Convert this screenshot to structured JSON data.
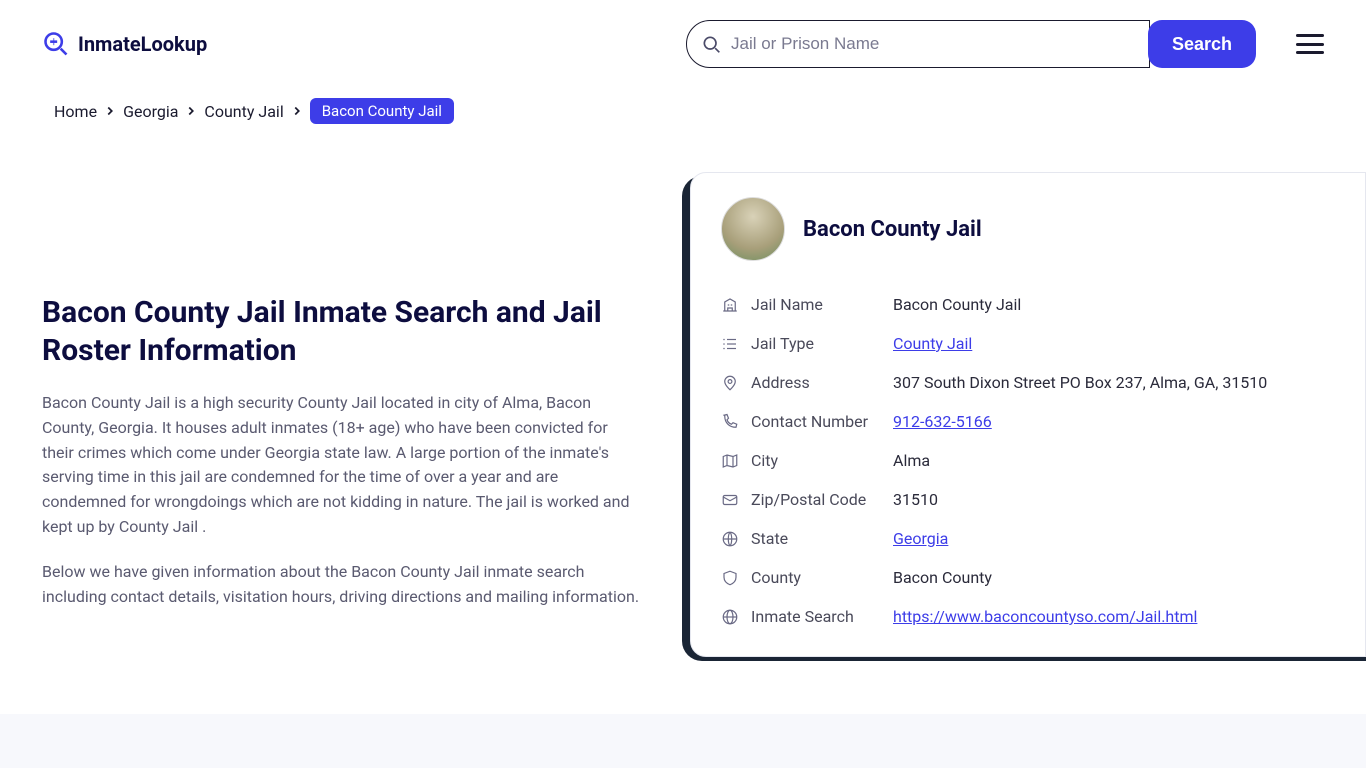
{
  "header": {
    "logo_text": "InmateLookup",
    "search_placeholder": "Jail or Prison Name",
    "search_button": "Search"
  },
  "breadcrumb": {
    "items": [
      "Home",
      "Georgia",
      "County Jail"
    ],
    "current": "Bacon County Jail"
  },
  "content": {
    "title": "Bacon County Jail Inmate Search and Jail Roster Information",
    "para1": "Bacon County Jail is a high security County Jail located in city of Alma, Bacon County, Georgia. It houses adult inmates (18+ age) who have been convicted for their crimes which come under Georgia state law. A large portion of the inmate's serving time in this jail are condemned for the time of over a year and are condemned for wrongdoings which are not kidding in nature. The jail is worked and kept up by County Jail .",
    "para2": "Below we have given information about the Bacon County Jail inmate search including contact details, visitation hours, driving directions and mailing information."
  },
  "card": {
    "title": "Bacon County Jail",
    "rows": [
      {
        "icon": "building",
        "label": "Jail Name",
        "value": "Bacon County Jail",
        "link": false
      },
      {
        "icon": "list",
        "label": "Jail Type",
        "value": "County Jail",
        "link": true
      },
      {
        "icon": "pin",
        "label": "Address",
        "value": "307 South Dixon Street PO Box 237, Alma, GA, 31510",
        "link": false
      },
      {
        "icon": "phone",
        "label": "Contact Number",
        "value": "912-632-5166",
        "link": true
      },
      {
        "icon": "map",
        "label": "City",
        "value": "Alma",
        "link": false
      },
      {
        "icon": "mail",
        "label": "Zip/Postal Code",
        "value": "31510",
        "link": false
      },
      {
        "icon": "globe",
        "label": "State",
        "value": "Georgia",
        "link": true
      },
      {
        "icon": "shield",
        "label": "County",
        "value": "Bacon County",
        "link": false
      },
      {
        "icon": "web",
        "label": "Inmate Search",
        "value": "https://www.baconcountyso.com/Jail.html",
        "link": true
      }
    ]
  }
}
